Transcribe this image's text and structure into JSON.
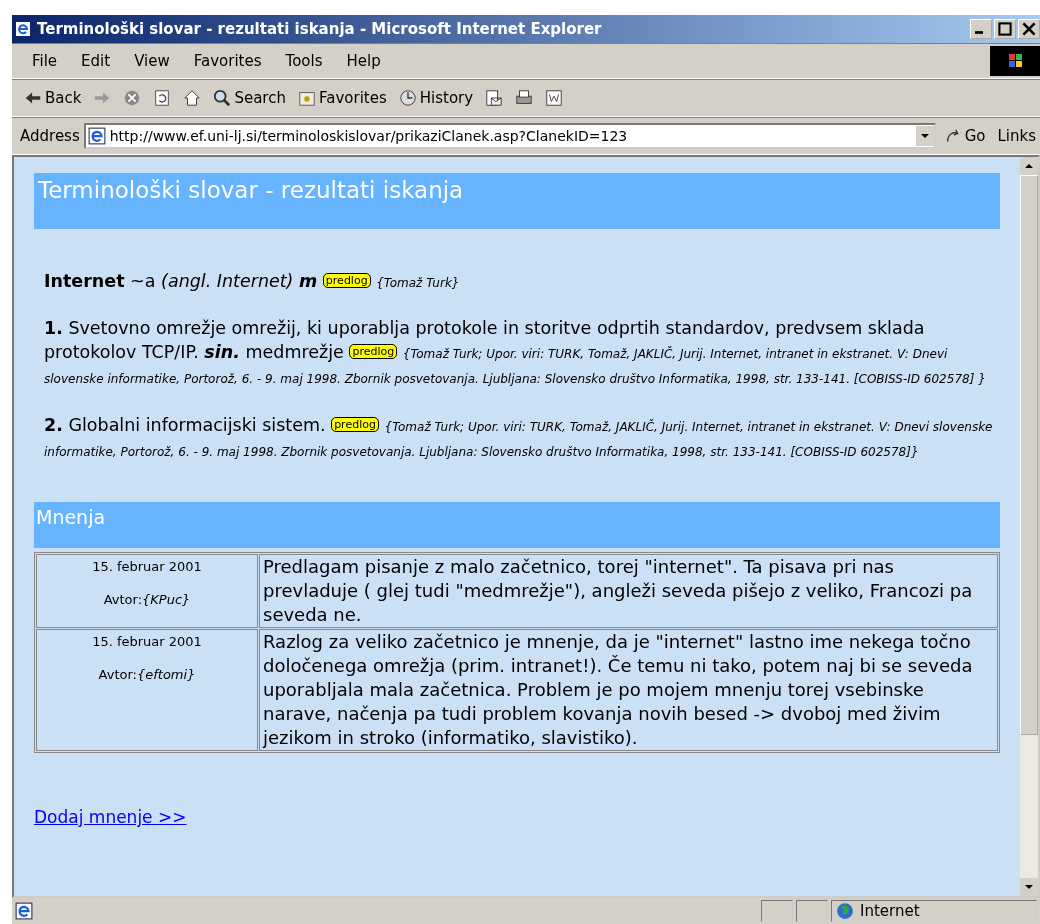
{
  "window": {
    "title": "Terminološki slovar - rezultati iskanja - Microsoft Internet Explorer"
  },
  "menu": [
    "File",
    "Edit",
    "View",
    "Favorites",
    "Tools",
    "Help"
  ],
  "toolbar": [
    {
      "kind": "back",
      "label": "Back"
    },
    {
      "kind": "forward"
    },
    {
      "kind": "stop"
    },
    {
      "kind": "refresh"
    },
    {
      "kind": "home"
    },
    {
      "kind": "search",
      "label": "Search"
    },
    {
      "kind": "favorites",
      "label": "Favorites"
    },
    {
      "kind": "history",
      "label": "History"
    },
    {
      "kind": "mail"
    },
    {
      "kind": "print"
    },
    {
      "kind": "edit"
    }
  ],
  "address": {
    "label": "Address",
    "url": "http://www.ef.uni-lj.si/terminoloskislovar/prikaziClanek.asp?ClanekID=123",
    "go": "Go",
    "links": "Links"
  },
  "page": {
    "heading": "Terminološki slovar - rezultati iskanja",
    "entry": {
      "term": "Internet",
      "suffix": "~a",
      "origin": "(angl. Internet)",
      "gender": "m",
      "badge": "predlog",
      "source": "{Tomaž Turk}"
    },
    "senses": [
      {
        "number": "1.",
        "text": "Svetovno omrežje omrežij, ki uporablja protokole in storitve odprtih standardov, predvsem sklada protokolov TCP/IP.",
        "syn_label": "sin.",
        "synonym": "medmrežje",
        "badge": "predlog",
        "source": "{Tomaž Turk; Upor. viri: TURK, Tomaž, JAKLIČ, Jurij. Internet, intranet in ekstranet. V: Dnevi slovenske informatike, Portorož, 6. - 9. maj 1998. Zbornik posvetovanja. Ljubljana: Slovensko društvo Informatika, 1998, str. 133-141. [COBISS-ID 602578] }"
      },
      {
        "number": "2.",
        "text": "Globalni informacijski sistem.",
        "badge": "predlog",
        "source": "{Tomaž Turk; Upor. viri: TURK, Tomaž, JAKLIČ, Jurij. Internet, intranet in ekstranet. V: Dnevi slovenske informatike, Portorož, 6. - 9. maj 1998. Zbornik posvetovanja. Ljubljana: Slovensko društvo Informatika, 1998, str. 133-141. [COBISS-ID 602578]}"
      }
    ],
    "opinions_heading": "Mnenja",
    "opinions": [
      {
        "date": "15. februar 2001",
        "author_label": "Avtor:",
        "author": "{KPuc}",
        "text": "Predlagam pisanje z malo začetnico, torej \"internet\". Ta pisava pri nas prevladuje ( glej tudi \"medmrežje\"), angleži seveda pišejo z veliko, Francozi pa seveda ne."
      },
      {
        "date": "15. februar 2001",
        "author_label": "Avtor:",
        "author": "{eftomi}",
        "text": "Razlog za veliko začetnico je mnenje, da je \"internet\" lastno ime nekega točno določenega omrežja (prim. intranet!). Če temu ni tako, potem naj bi se seveda uporabljala mala začetnica. Problem je po mojem mnenju torej vsebinske narave, načenja pa tudi problem kovanja novih besed -> dvoboj med živim jezikom in stroko (informatiko, slavistiko)."
      }
    ],
    "add_link": "Dodaj mnenje >>"
  },
  "status_bar": {
    "zone": "Internet"
  }
}
